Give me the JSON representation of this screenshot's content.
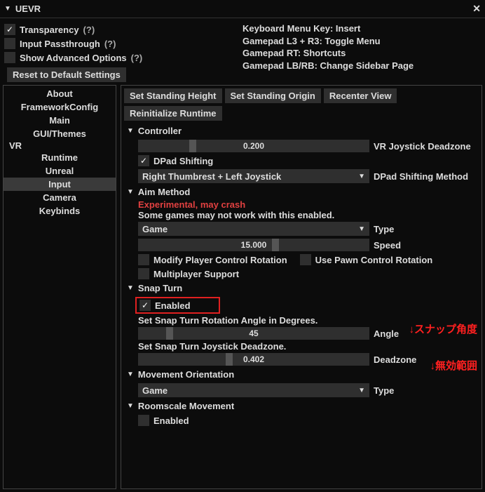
{
  "window": {
    "title": "UEVR"
  },
  "options": {
    "transparency": {
      "label": "Transparency",
      "help": "(?)",
      "checked": true
    },
    "passthrough": {
      "label": "Input Passthrough",
      "help": "(?)",
      "checked": false
    },
    "advanced": {
      "label": "Show Advanced Options",
      "help": "(?)",
      "checked": false
    },
    "reset": {
      "label": "Reset to Default Settings"
    }
  },
  "info": {
    "l1": "Keyboard Menu Key: Insert",
    "l2": "Gamepad L3 + R3: Toggle Menu",
    "l3": "Gamepad RT: Shortcuts",
    "l4": "Gamepad LB/RB: Change Sidebar Page"
  },
  "nav": {
    "about": "About",
    "framework": "FrameworkConfig",
    "main": "Main",
    "gui": "GUI/Themes",
    "vr": "VR",
    "runtime": "Runtime",
    "unreal": "Unreal",
    "input": "Input",
    "camera": "Camera",
    "keybinds": "Keybinds"
  },
  "buttons": {
    "standing_height": "Set Standing Height",
    "standing_origin": "Set Standing Origin",
    "recenter": "Recenter View",
    "reinit": "Reinitialize Runtime"
  },
  "controller": {
    "header": "Controller",
    "deadzone_val": "0.200",
    "deadzone_lbl": "VR Joystick Deadzone",
    "dpad_shift": "DPad Shifting",
    "dpad_method_val": "Right Thumbrest + Left Joystick",
    "dpad_method_lbl": "DPad Shifting Method"
  },
  "aim": {
    "header": "Aim Method",
    "warn": "Experimental, may crash",
    "note": "Some games may not work with this enabled.",
    "type_val": "Game",
    "type_lbl": "Type",
    "speed_val": "15.000",
    "speed_lbl": "Speed",
    "modify_rot": "Modify Player Control Rotation",
    "pawn_rot": "Use Pawn Control Rotation",
    "multiplayer": "Multiplayer Support"
  },
  "snap": {
    "header": "Snap Turn",
    "enabled": "Enabled",
    "angle_note": "Set Snap Turn Rotation Angle in Degrees.",
    "angle_val": "45",
    "angle_lbl": "Angle",
    "dz_note": "Set Snap Turn Joystick Deadzone.",
    "dz_val": "0.402",
    "dz_lbl": "Deadzone"
  },
  "move": {
    "header": "Movement Orientation",
    "type_val": "Game",
    "type_lbl": "Type"
  },
  "room": {
    "header": "Roomscale Movement",
    "enabled": "Enabled"
  },
  "annotations": {
    "snap_angle": "↓スナップ角度",
    "invalid_range": "↓無効範囲"
  }
}
